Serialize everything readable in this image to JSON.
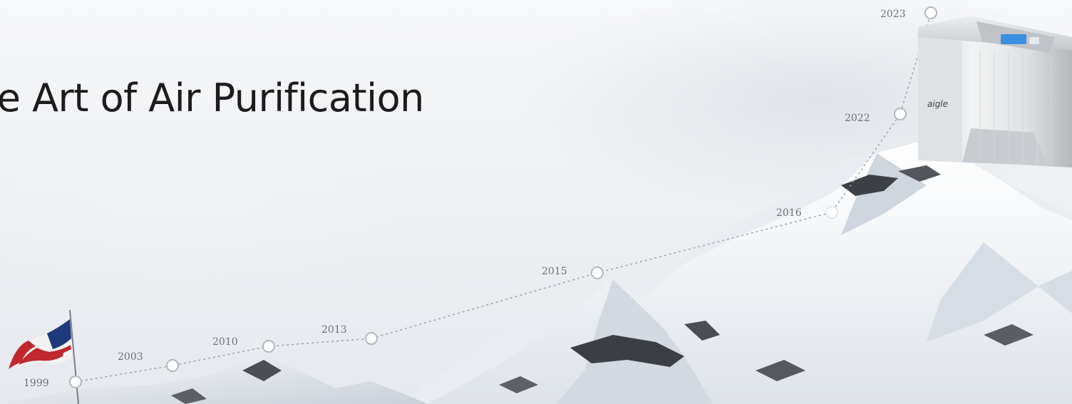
{
  "hero": {
    "title": "he Art of Air Purification",
    "product_brand": "aigle",
    "timeline": [
      {
        "year": "1999"
      },
      {
        "year": "2003"
      },
      {
        "year": "2010"
      },
      {
        "year": "2013"
      },
      {
        "year": "2015"
      },
      {
        "year": "2016"
      },
      {
        "year": "2022"
      },
      {
        "year": "2023"
      }
    ]
  }
}
